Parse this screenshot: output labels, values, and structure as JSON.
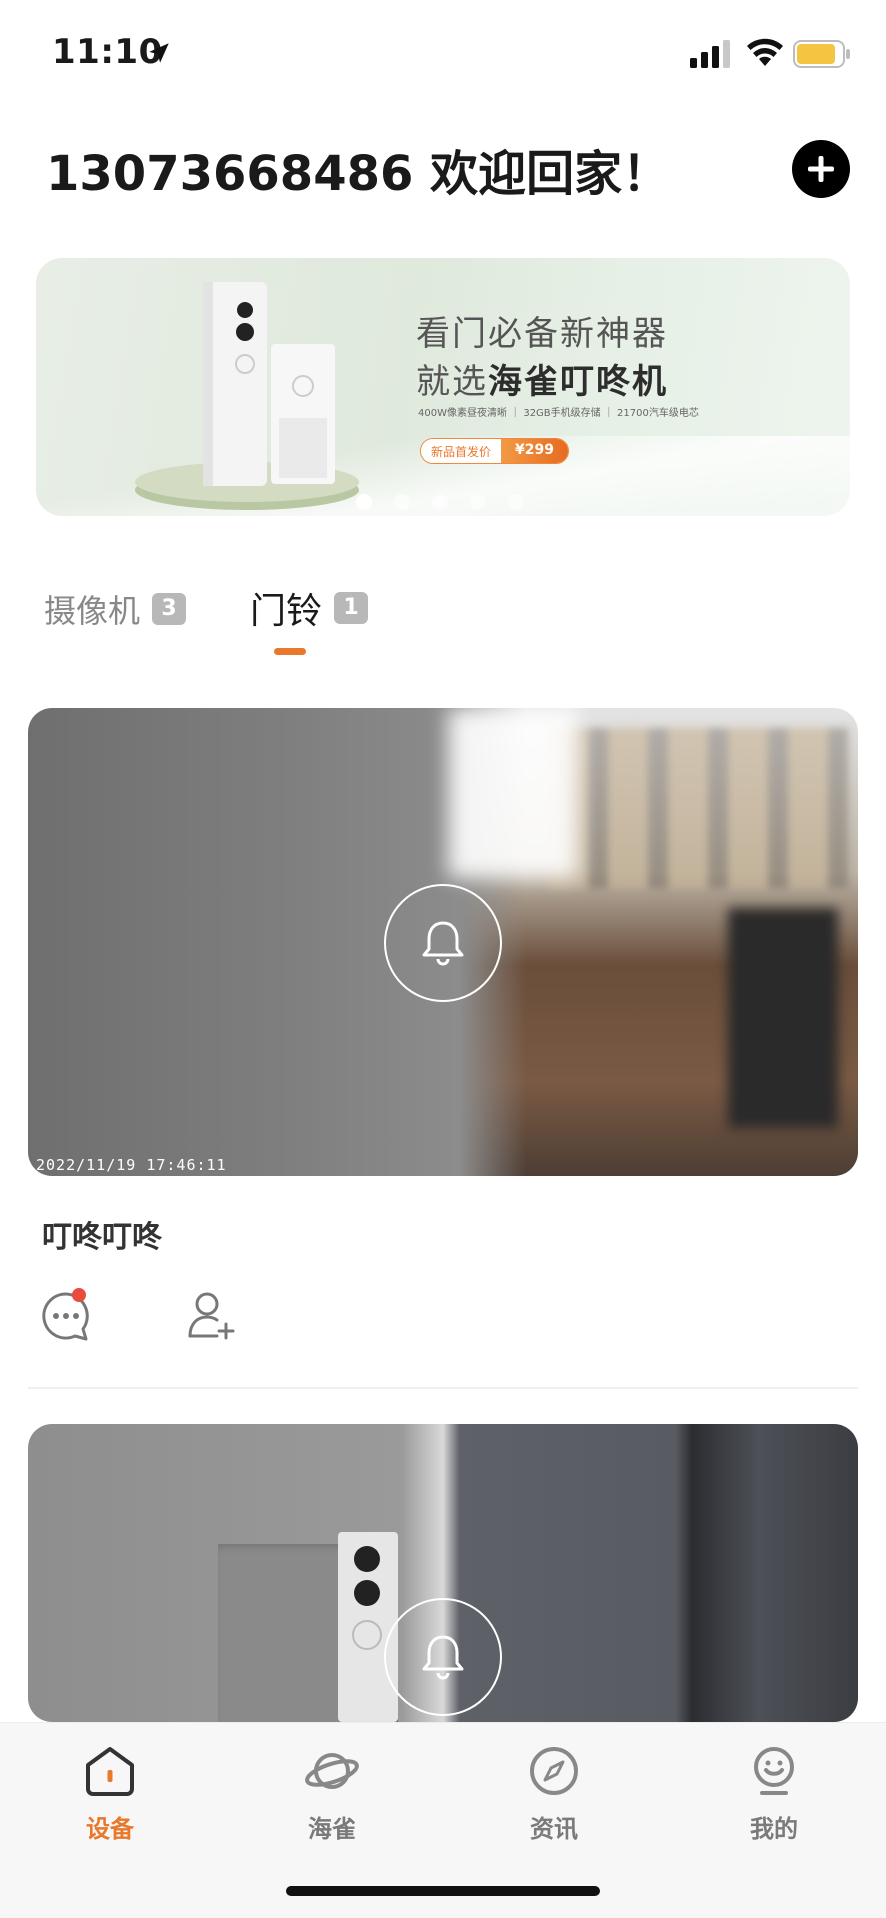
{
  "status_bar": {
    "time": "11:10"
  },
  "header": {
    "greeting": "13073668486 欢迎回家！"
  },
  "banner": {
    "title_line1": "看门必备新神器",
    "title_line2_prefix": "就选",
    "title_line2_bold": "海雀叮咚机",
    "specs": "400W像素昼夜清晰 ｜ 32GB手机级存储 ｜ 21700汽车级电芯",
    "price_label": "新品首发价",
    "price_value": "¥299",
    "slide_count": 5,
    "active_slide": 1
  },
  "tabs": [
    {
      "label": "摄像机",
      "count": "3",
      "active": false
    },
    {
      "label": "门铃",
      "count": "1",
      "active": true
    }
  ],
  "devices": [
    {
      "name": "叮咚叮咚",
      "timestamp": "2022/11/19  17:46:11",
      "has_unread": true
    }
  ],
  "bottom_nav": [
    {
      "label": "设备",
      "icon": "home-icon",
      "active": true
    },
    {
      "label": "海雀",
      "icon": "planet-icon",
      "active": false
    },
    {
      "label": "资讯",
      "icon": "compass-icon",
      "active": false
    },
    {
      "label": "我的",
      "icon": "profile-icon",
      "active": false
    }
  ],
  "colors": {
    "accent": "#e9772c",
    "badge": "#e74c3c",
    "battery": "#f5c542"
  }
}
